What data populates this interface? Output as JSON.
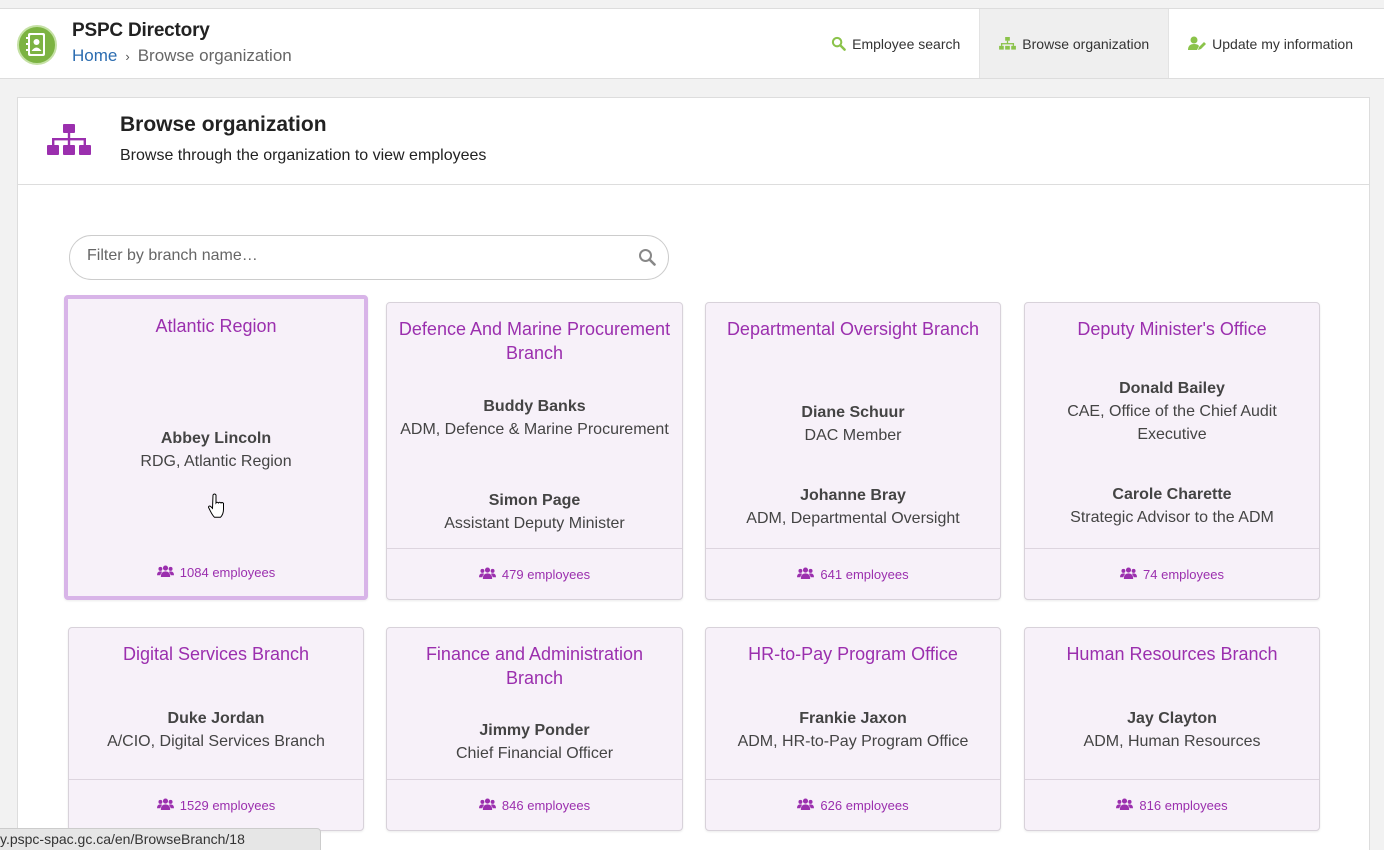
{
  "app": {
    "title": "PSPC Directory",
    "brand_color": "#7cb342",
    "accent_color": "#9b2fae"
  },
  "breadcrumb": {
    "home": "Home",
    "separator": "›",
    "current": "Browse organization"
  },
  "nav": [
    {
      "label": "Employee search",
      "icon": "search-icon",
      "active": false
    },
    {
      "label": "Browse organization",
      "icon": "org-chart-icon",
      "active": true
    },
    {
      "label": "Update my information",
      "icon": "user-edit-icon",
      "active": false
    }
  ],
  "page": {
    "title": "Browse organization",
    "subtitle": "Browse through the organization to view employees",
    "icon": "org-chart-icon"
  },
  "filter": {
    "placeholder": "Filter by branch name…",
    "value": ""
  },
  "branches": [
    {
      "name": "Atlantic Region",
      "people": [
        {
          "name": "Abbey Lincoln",
          "role": "RDG, Atlantic Region"
        }
      ],
      "count": "1084 employees",
      "selected": true
    },
    {
      "name": "Defence And Marine Procurement Branch",
      "people": [
        {
          "name": "Buddy Banks",
          "role": "ADM, Defence & Marine Procurement"
        },
        {
          "name": "Simon Page",
          "role": "Assistant Deputy Minister"
        }
      ],
      "count": "479 employees"
    },
    {
      "name": "Departmental Oversight Branch",
      "people": [
        {
          "name": "Diane Schuur",
          "role": "DAC Member"
        },
        {
          "name": "Johanne Bray",
          "role": "ADM, Departmental Oversight"
        }
      ],
      "count": "641 employees"
    },
    {
      "name": "Deputy Minister's Office",
      "people": [
        {
          "name": "Donald Bailey",
          "role": "CAE, Office of the Chief Audit Executive"
        },
        {
          "name": "Carole Charette",
          "role": "Strategic Advisor to the ADM"
        }
      ],
      "count": "74 employees"
    },
    {
      "name": "Digital Services Branch",
      "people": [
        {
          "name": "Duke Jordan",
          "role": "A/CIO, Digital Services Branch"
        }
      ],
      "count": "1529 employees"
    },
    {
      "name": "Finance and Administration Branch",
      "people": [
        {
          "name": "Jimmy Ponder",
          "role": "Chief Financial Officer"
        }
      ],
      "count": "846 employees"
    },
    {
      "name": "HR-to-Pay Program Office",
      "people": [
        {
          "name": "Frankie Jaxon",
          "role": "ADM, HR-to-Pay Program Office"
        }
      ],
      "count": "626 employees"
    },
    {
      "name": "Human Resources Branch",
      "people": [
        {
          "name": "Jay Clayton",
          "role": "ADM, Human Resources"
        }
      ],
      "count": "816 employees"
    }
  ],
  "status_bar": {
    "url": "y.pspc-spac.gc.ca/en/BrowseBranch/18"
  }
}
